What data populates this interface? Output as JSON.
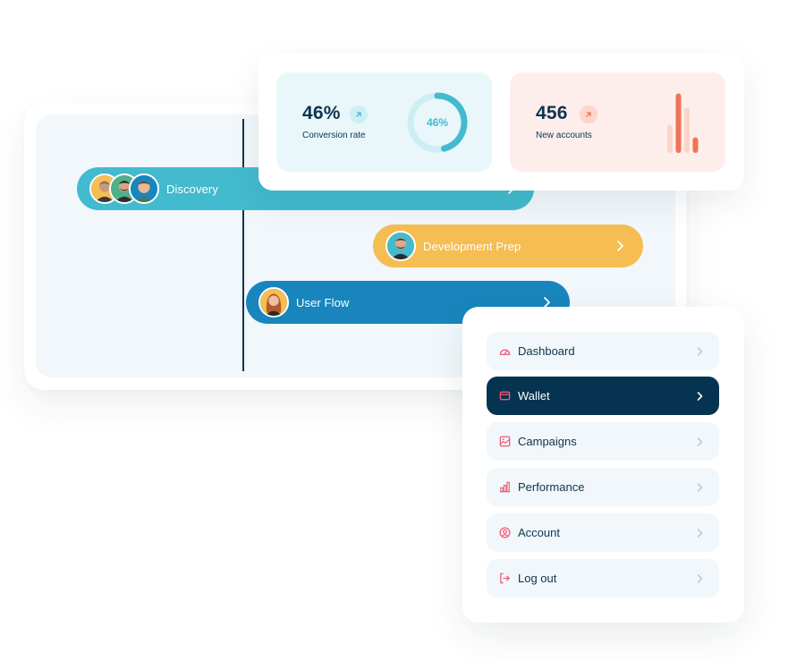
{
  "timeline": {
    "tasks": [
      {
        "label": "Discovery",
        "color": "#43bace",
        "avatars": [
          "person-1",
          "person-2",
          "person-3"
        ]
      },
      {
        "label": "Development Prep",
        "color": "#f5bd52",
        "avatars": [
          "person-4"
        ]
      },
      {
        "label": "User Flow",
        "color": "#1886bd",
        "avatars": [
          "person-5"
        ]
      }
    ]
  },
  "stats": {
    "conversion": {
      "value": "46%",
      "caption": "Conversion rate",
      "donut_label": "46%",
      "donut_fraction": 0.46,
      "accent": "#43bace",
      "track": "#cdeef4",
      "trend_icon": "arrow-up-right-icon"
    },
    "accounts": {
      "value": "456",
      "caption": "New accounts",
      "accent": "#f07356",
      "light": "#fdd3c8",
      "trend_icon": "arrow-up-right-icon",
      "bars": [
        0.45,
        0.95,
        0.72,
        0.25
      ]
    }
  },
  "menu": {
    "items": [
      {
        "label": "Dashboard",
        "icon": "gauge-icon",
        "active": false
      },
      {
        "label": "Wallet",
        "icon": "wallet-icon",
        "active": true
      },
      {
        "label": "Campaigns",
        "icon": "image-icon",
        "active": false
      },
      {
        "label": "Performance",
        "icon": "bar-chart-icon",
        "active": false
      },
      {
        "label": "Account",
        "icon": "user-circle-icon",
        "active": false
      },
      {
        "label": "Log out",
        "icon": "logout-icon",
        "active": false
      }
    ],
    "icon_color": "#ef5a7a"
  }
}
